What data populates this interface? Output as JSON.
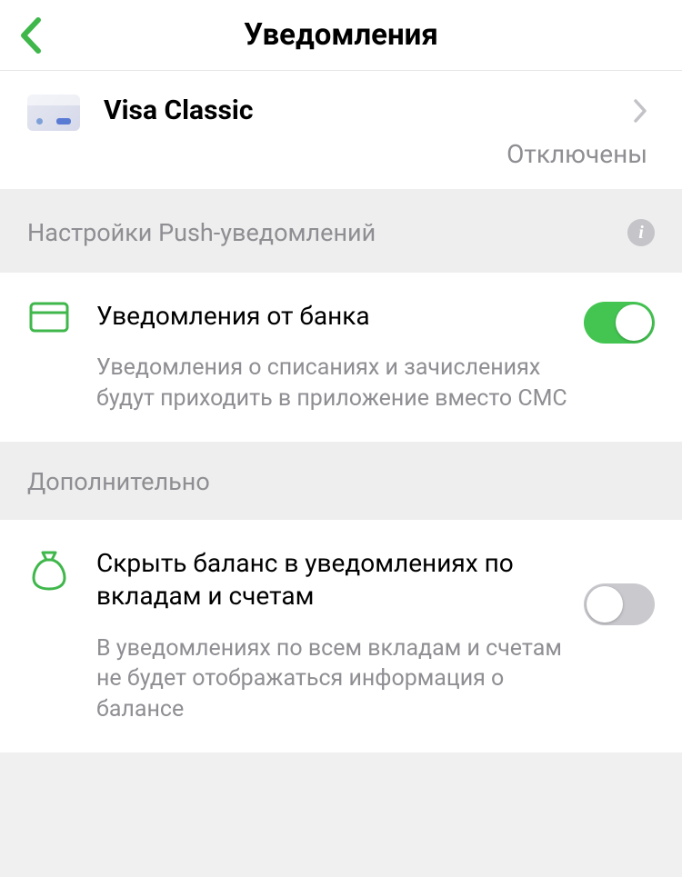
{
  "header": {
    "title": "Уведомления"
  },
  "card": {
    "name": "Visa Classic",
    "status": "Отключены"
  },
  "sections": {
    "push": {
      "title": "Настройки Push-уведомлений"
    },
    "additional": {
      "title": "Дополнительно"
    }
  },
  "settings": {
    "bank_notifications": {
      "title": "Уведомления от банка",
      "description": "Уведомления о списаниях и зачислениях будут приходить в приложение вместо СМС",
      "enabled": true
    },
    "hide_balance": {
      "title": "Скрыть баланс в уведомлениях по вкладам и счетам",
      "description": "В уведомлениях по всем вкладам и счетам не будет отображаться информация о балансе",
      "enabled": false
    }
  },
  "icons": {
    "info": "i"
  }
}
